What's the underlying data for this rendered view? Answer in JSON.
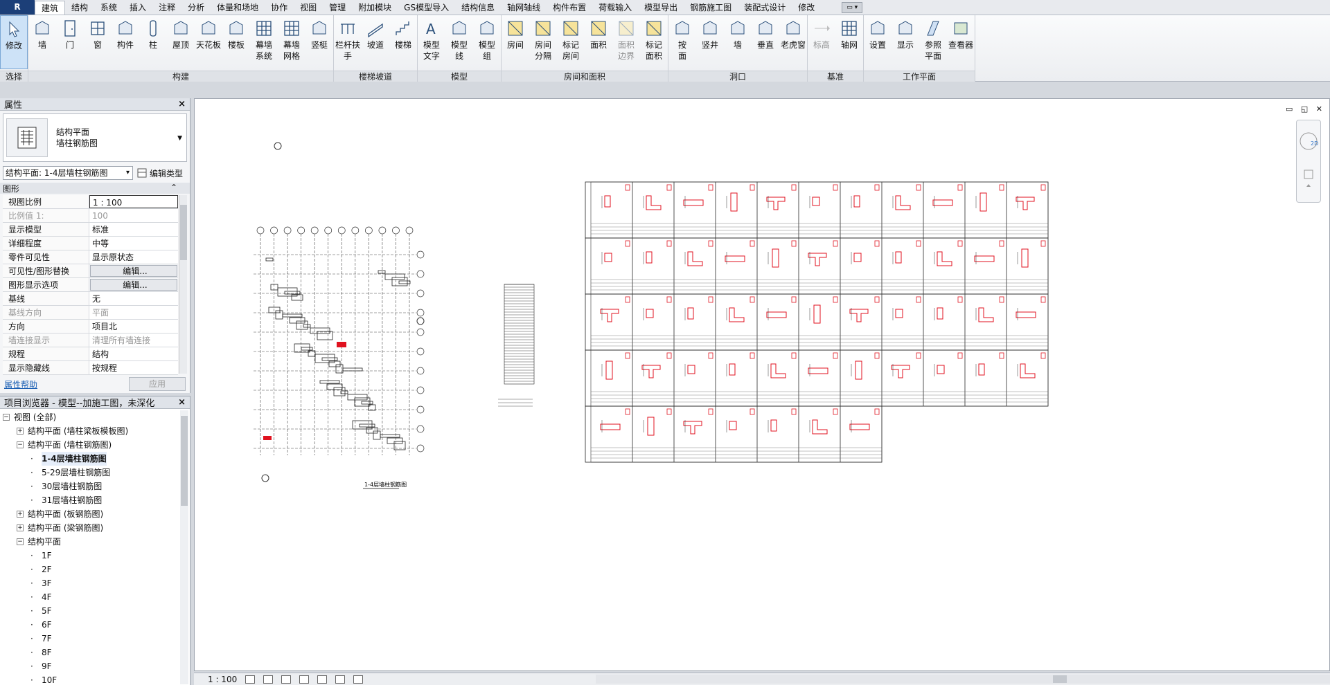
{
  "ribbon_tabs": [
    "建筑",
    "结构",
    "系统",
    "插入",
    "注释",
    "分析",
    "体量和场地",
    "协作",
    "视图",
    "管理",
    "附加模块",
    "GS模型导入",
    "结构信息",
    "轴网轴线",
    "构件布置",
    "荷载输入",
    "模型导出",
    "钢筋施工图",
    "装配式设计",
    "修改"
  ],
  "ribbon_groups": [
    {
      "label": "选择",
      "buttons": [
        {
          "label": "修改",
          "icon": "cursor-icon"
        }
      ]
    },
    {
      "label": "构建",
      "buttons": [
        {
          "label": "墙",
          "icon": "wall-icon"
        },
        {
          "label": "门",
          "icon": "door-icon"
        },
        {
          "label": "窗",
          "icon": "window-icon"
        },
        {
          "label": "构件",
          "icon": "component-icon"
        },
        {
          "label": "柱",
          "icon": "column-icon"
        },
        {
          "label": "屋顶",
          "icon": "roof-icon"
        },
        {
          "label": "天花板",
          "icon": "ceiling-icon"
        },
        {
          "label": "楼板",
          "icon": "floor-icon"
        },
        {
          "label": "幕墙\n系统",
          "icon": "curtain-system-icon"
        },
        {
          "label": "幕墙\n网格",
          "icon": "curtain-grid-icon"
        },
        {
          "label": "竖梃",
          "icon": "mullion-icon"
        }
      ]
    },
    {
      "label": "楼梯坡道",
      "buttons": [
        {
          "label": "栏杆扶手",
          "icon": "railing-icon"
        },
        {
          "label": "坡道",
          "icon": "ramp-icon"
        },
        {
          "label": "楼梯",
          "icon": "stair-icon"
        }
      ]
    },
    {
      "label": "模型",
      "buttons": [
        {
          "label": "模型\n文字",
          "icon": "model-text-icon"
        },
        {
          "label": "模型\n线",
          "icon": "model-line-icon"
        },
        {
          "label": "模型\n组",
          "icon": "model-group-icon"
        }
      ]
    },
    {
      "label": "房间和面积",
      "buttons": [
        {
          "label": "房间",
          "icon": "room-icon"
        },
        {
          "label": "房间\n分隔",
          "icon": "room-separator-icon"
        },
        {
          "label": "标记\n房间",
          "icon": "tag-room-icon"
        },
        {
          "label": "面积",
          "icon": "area-icon"
        },
        {
          "label": "面积\n边界",
          "icon": "area-boundary-icon",
          "disabled": true
        },
        {
          "label": "标记\n面积",
          "icon": "tag-area-icon"
        }
      ]
    },
    {
      "label": "洞口",
      "buttons": [
        {
          "label": "按\n面",
          "icon": "by-face-icon"
        },
        {
          "label": "竖井",
          "icon": "shaft-icon"
        },
        {
          "label": "墙",
          "icon": "wall-opening-icon"
        },
        {
          "label": "垂直",
          "icon": "vertical-icon"
        },
        {
          "label": "老虎窗",
          "icon": "dormer-icon"
        }
      ]
    },
    {
      "label": "基准",
      "buttons": [
        {
          "label": "标高",
          "icon": "level-icon",
          "disabled": true
        },
        {
          "label": "轴网",
          "icon": "grid-icon"
        }
      ]
    },
    {
      "label": "工作平面",
      "buttons": [
        {
          "label": "设置",
          "icon": "set-icon"
        },
        {
          "label": "显示",
          "icon": "show-icon"
        },
        {
          "label": "参照\n平面",
          "icon": "ref-plane-icon"
        },
        {
          "label": "查看器",
          "icon": "viewer-icon"
        }
      ]
    }
  ],
  "properties": {
    "title": "属性",
    "type_line1": "结构平面",
    "type_line2": "墙柱钢筋图",
    "instance": "结构平面: 1-4层墙柱钢筋图",
    "edit_type": "编辑类型",
    "category": "图形",
    "rows": [
      {
        "k": "视图比例",
        "v": "1 : 100",
        "style": "box"
      },
      {
        "k": "比例值 1:",
        "v": "100",
        "dis": true
      },
      {
        "k": "显示模型",
        "v": "标准"
      },
      {
        "k": "详细程度",
        "v": "中等"
      },
      {
        "k": "零件可见性",
        "v": "显示原状态"
      },
      {
        "k": "可见性/图形替换",
        "v": "编辑...",
        "style": "btn"
      },
      {
        "k": "图形显示选项",
        "v": "编辑...",
        "style": "btn"
      },
      {
        "k": "基线",
        "v": "无"
      },
      {
        "k": "基线方向",
        "v": "平面",
        "dis": true
      },
      {
        "k": "方向",
        "v": "项目北"
      },
      {
        "k": "墙连接显示",
        "v": "清理所有墙连接",
        "dis": true
      },
      {
        "k": "规程",
        "v": "结构"
      },
      {
        "k": "显示隐藏线",
        "v": "按规程"
      }
    ],
    "help": "属性帮助",
    "apply": "应用"
  },
  "browser": {
    "title": "项目浏览器 - 模型--加施工图，未深化",
    "nodes": [
      {
        "label": "视图 (全部)",
        "indent": 0,
        "exp": "−"
      },
      {
        "label": "结构平面 (墙柱梁板模板图)",
        "indent": 1,
        "exp": "+"
      },
      {
        "label": "结构平面 (墙柱钢筋图)",
        "indent": 1,
        "exp": "−"
      },
      {
        "label": "1-4层墙柱钢筋图",
        "indent": 2,
        "sel": true
      },
      {
        "label": "5-29层墙柱钢筋图",
        "indent": 2
      },
      {
        "label": "30层墙柱钢筋图",
        "indent": 2
      },
      {
        "label": "31层墙柱钢筋图",
        "indent": 2
      },
      {
        "label": "结构平面 (板钢筋图)",
        "indent": 1,
        "exp": "+"
      },
      {
        "label": "结构平面 (梁钢筋图)",
        "indent": 1,
        "exp": "+"
      },
      {
        "label": "结构平面",
        "indent": 1,
        "exp": "−"
      },
      {
        "label": "1F",
        "indent": 2
      },
      {
        "label": "2F",
        "indent": 2
      },
      {
        "label": "3F",
        "indent": 2
      },
      {
        "label": "4F",
        "indent": 2
      },
      {
        "label": "5F",
        "indent": 2
      },
      {
        "label": "6F",
        "indent": 2
      },
      {
        "label": "7F",
        "indent": 2
      },
      {
        "label": "8F",
        "indent": 2
      },
      {
        "label": "9F",
        "indent": 2
      },
      {
        "label": "10F",
        "indent": 2
      }
    ]
  },
  "drawing": {
    "plan_title": "1-4层墙柱钢筋图",
    "table_rows": 5,
    "table_cols": 11,
    "last_row_cols": 7,
    "accent_red": "#e0121f"
  },
  "status": {
    "scale": "1 : 100"
  }
}
